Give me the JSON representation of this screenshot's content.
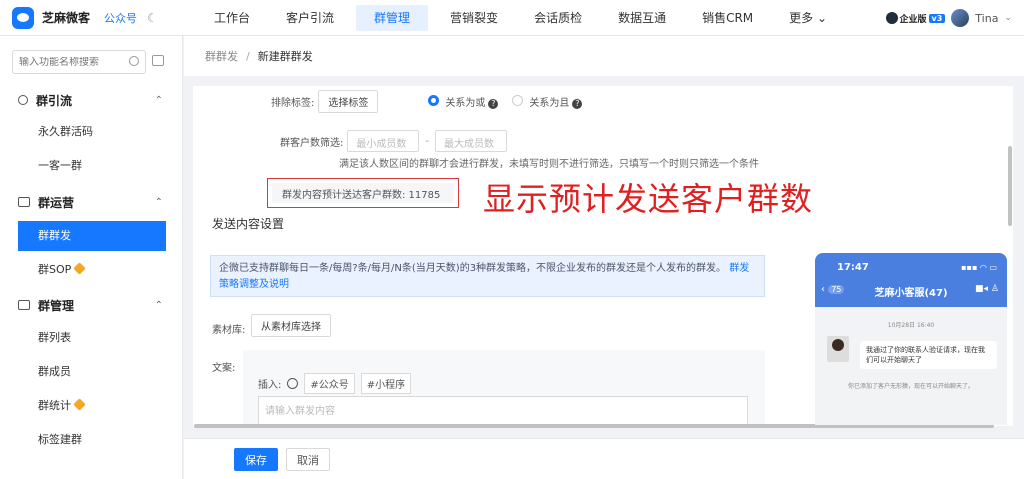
{
  "app": {
    "name": "芝麻微客",
    "official_account": "公众号",
    "theme_icon": "moon-icon"
  },
  "nav": {
    "items": [
      "工作台",
      "客户引流",
      "群管理",
      "营销裂变",
      "会话质检",
      "数据互通",
      "销售CRM",
      "更多"
    ],
    "active": "群管理",
    "enterprise_badge": "企业版",
    "version_badge": "v3",
    "user": "Tina"
  },
  "sidebar": {
    "search_placeholder": "输入功能名称搜索",
    "groups": [
      {
        "label": "群引流",
        "items": [
          "永久群活码",
          "一客一群"
        ]
      },
      {
        "label": "群运营",
        "items": [
          "群群发",
          "群SOP"
        ]
      },
      {
        "label": "群管理",
        "items": [
          "群列表",
          "群成员",
          "群统计",
          "标签建群"
        ]
      }
    ],
    "active_item": "群群发"
  },
  "breadcrumb": {
    "parent": "群群发",
    "sep": "/",
    "current": "新建群群发"
  },
  "form": {
    "exclude_tag_label": "排除标签:",
    "select_tag_btn": "选择标签",
    "relation_or": "关系为或",
    "relation_and": "关系为且",
    "size_filter_label": "群客户数筛选:",
    "min_placeholder": "最小成员数",
    "dash": "-",
    "max_placeholder": "最大成员数",
    "size_hint": "满足该人数区间的群聊才会进行群发，未填写时则不进行筛选，只填写一个时则只筛选一个条件",
    "estimate_text": "群发内容预计送达客户群数: 11785",
    "annotation": "显示预计发送客户群数",
    "section_title": "发送内容设置",
    "notice": "企微已支持群聊每日一条/每周?条/每月/N条(当月天数)的3种群发策略，不限企业发布的群发还是个人发布的群发。",
    "notice_link": "群发策略调整及说明",
    "library_label": "素材库:",
    "library_btn": "从素材库选择",
    "text_label": "文案:",
    "insert_label": "插入:",
    "insert_official": "#公众号",
    "insert_mini": "#小程序",
    "text_placeholder": "请输入群发内容"
  },
  "phone": {
    "time": "17:47",
    "back_count": "75",
    "title": "芝麻小客服(47)",
    "date": "10月28日 16:40",
    "message": "我通过了你的联系人验证请求，现在我们可以开始聊天了",
    "system": "你已添加了客户无形猿，现在可以开始聊天了。"
  },
  "footer": {
    "save": "保存",
    "cancel": "取消"
  },
  "colors": {
    "primary": "#1677ff",
    "annotation": "#e02020"
  }
}
